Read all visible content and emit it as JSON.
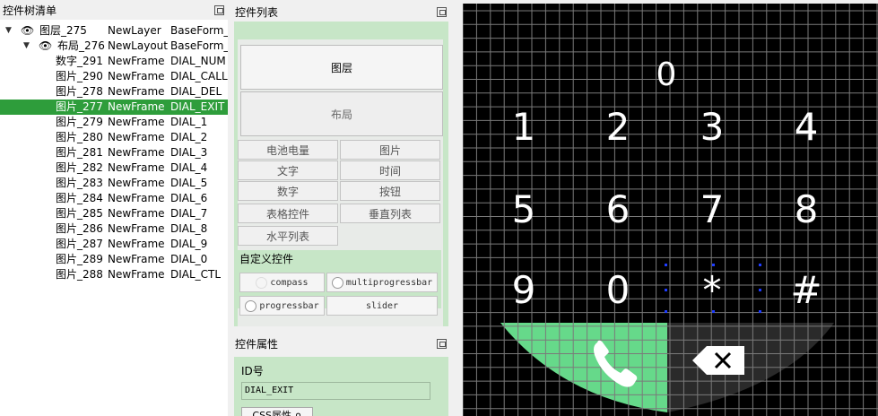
{
  "tree_panel": {
    "title": "控件树清单",
    "rows": [
      {
        "col1": "图层_275",
        "col2": "NewLayer",
        "col3": "BaseForm_",
        "level": 0,
        "arrow": "▼",
        "eye": true
      },
      {
        "col1": "布局_276",
        "col2": "NewLayout",
        "col3": "BaseForm_",
        "level": 1,
        "arrow": "▼",
        "eye": true
      },
      {
        "col1": "数字_291",
        "col2": "NewFrame",
        "col3": "DIAL_NUM"
      },
      {
        "col1": "图片_290",
        "col2": "NewFrame",
        "col3": "DIAL_CALL"
      },
      {
        "col1": "图片_278",
        "col2": "NewFrame",
        "col3": "DIAL_DEL"
      },
      {
        "col1": "图片_277",
        "col2": "NewFrame",
        "col3": "DIAL_EXIT",
        "selected": true
      },
      {
        "col1": "图片_279",
        "col2": "NewFrame",
        "col3": "DIAL_1"
      },
      {
        "col1": "图片_280",
        "col2": "NewFrame",
        "col3": "DIAL_2"
      },
      {
        "col1": "图片_281",
        "col2": "NewFrame",
        "col3": "DIAL_3"
      },
      {
        "col1": "图片_282",
        "col2": "NewFrame",
        "col3": "DIAL_4"
      },
      {
        "col1": "图片_283",
        "col2": "NewFrame",
        "col3": "DIAL_5"
      },
      {
        "col1": "图片_284",
        "col2": "NewFrame",
        "col3": "DIAL_6"
      },
      {
        "col1": "图片_285",
        "col2": "NewFrame",
        "col3": "DIAL_7"
      },
      {
        "col1": "图片_286",
        "col2": "NewFrame",
        "col3": "DIAL_8"
      },
      {
        "col1": "图片_287",
        "col2": "NewFrame",
        "col3": "DIAL_9"
      },
      {
        "col1": "图片_289",
        "col2": "NewFrame",
        "col3": "DIAL_0"
      },
      {
        "col1": "图片_288",
        "col2": "NewFrame",
        "col3": "DIAL_CTL"
      }
    ]
  },
  "widgets_panel": {
    "title": "控件列表",
    "layer_btn": "图层",
    "layout_btn": "布局",
    "buttons": [
      "电池电量",
      "图片",
      "文字",
      "时间",
      "数字",
      "按钮",
      "表格控件",
      "垂直列表",
      "水平列表"
    ],
    "custom_title": "自定义控件",
    "custom_buttons": [
      "compass",
      "multiprogressbar",
      "progressbar",
      "slider"
    ]
  },
  "props_panel": {
    "title": "控件属性",
    "id_label": "ID号",
    "id_value": "DIAL_EXIT",
    "css_btn": "CSS属性 ∩"
  },
  "dialpad": {
    "top_number": "0",
    "keys": [
      "1",
      "2",
      "3",
      "4",
      "5",
      "6",
      "7",
      "8",
      "9",
      "0",
      "*",
      "#"
    ],
    "call_color": "#66d98a",
    "delete_color": "#2a2a2a",
    "grid_color": "#7a7a7a"
  },
  "colors": {
    "selection": "#2e9d3b",
    "panel_green": "#c7e6c7"
  }
}
